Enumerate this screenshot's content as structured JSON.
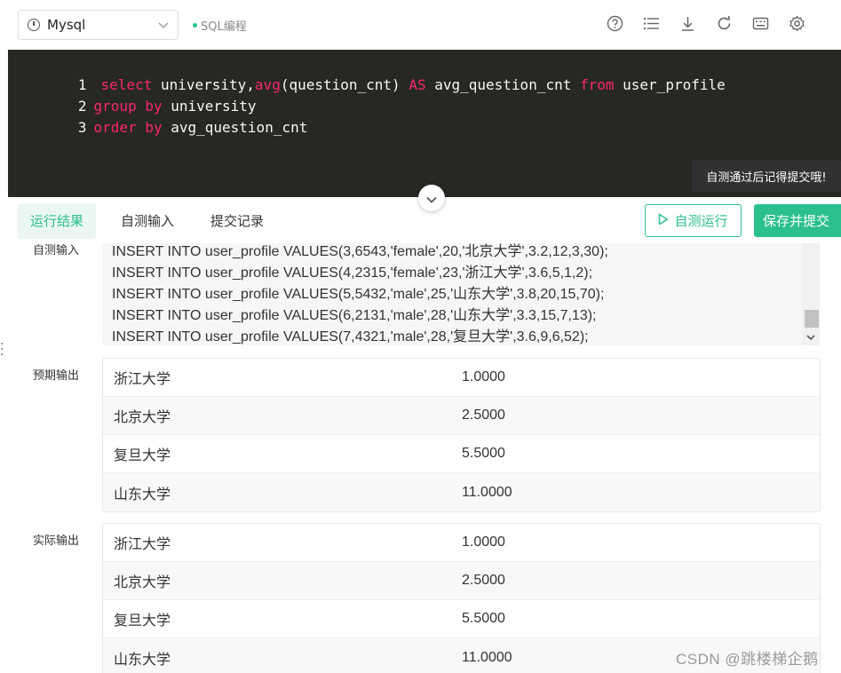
{
  "toolbar": {
    "db_selected": "Mysql",
    "mode_label": "SQL编程",
    "icons": [
      "help-circle-icon",
      "list-icon",
      "download-icon",
      "refresh-icon",
      "keyboard-icon",
      "gear-icon"
    ]
  },
  "editor": {
    "lines": [
      {
        "num": "1",
        "tokens": [
          {
            "t": "kw",
            "v": "select"
          },
          {
            "t": "tx",
            "v": " university,"
          },
          {
            "t": "kw",
            "v": "avg"
          },
          {
            "t": "tx",
            "v": "(question_cnt) "
          },
          {
            "t": "kw",
            "v": "AS"
          },
          {
            "t": "tx",
            "v": " avg_question_cnt "
          },
          {
            "t": "kw",
            "v": "from"
          },
          {
            "t": "tx",
            "v": " user_profile"
          }
        ]
      },
      {
        "num": "2",
        "tokens": [
          {
            "t": "kw",
            "v": "group by"
          },
          {
            "t": "tx",
            "v": " university"
          }
        ]
      },
      {
        "num": "3",
        "tokens": [
          {
            "t": "kw",
            "v": "order by"
          },
          {
            "t": "tx",
            "v": " avg_question_cnt"
          }
        ]
      }
    ],
    "tooltip": "自测通过后记得提交哦!"
  },
  "tabs": {
    "result": "运行结果",
    "custom_input": "自测输入",
    "submit_history": "提交记录"
  },
  "buttons": {
    "self_test": "自测运行",
    "save_submit": "保存并提交"
  },
  "result": {
    "input_label": "自测输入",
    "input_lines": [
      "INSERT INTO user_profile VALUES(3,6543,'female',20,'北京大学',3.2,12,3,30);",
      "INSERT INTO user_profile VALUES(4,2315,'female',23,'浙江大学',3.6,5,1,2);",
      "INSERT INTO user_profile VALUES(5,5432,'male',25,'山东大学',3.8,20,15,70);",
      "INSERT INTO user_profile VALUES(6,2131,'male',28,'山东大学',3.3,15,7,13);",
      "INSERT INTO user_profile VALUES(7,4321,'male',28,'复旦大学',3.6,9,6,52);"
    ],
    "expected_label": "预期输出",
    "expected_rows": [
      [
        "浙江大学",
        "1.0000"
      ],
      [
        "北京大学",
        "2.5000"
      ],
      [
        "复旦大学",
        "5.5000"
      ],
      [
        "山东大学",
        "11.0000"
      ]
    ],
    "actual_label": "实际输出",
    "actual_rows": [
      [
        "浙江大学",
        "1.0000"
      ],
      [
        "北京大学",
        "2.5000"
      ],
      [
        "复旦大学",
        "5.5000"
      ],
      [
        "山东大学",
        "11.0000"
      ]
    ]
  },
  "watermark": "CSDN @跳楼梯企鹅",
  "colors": {
    "accent": "#2bbf8f",
    "editor_bg": "#272822",
    "keyword": "#f92672"
  }
}
